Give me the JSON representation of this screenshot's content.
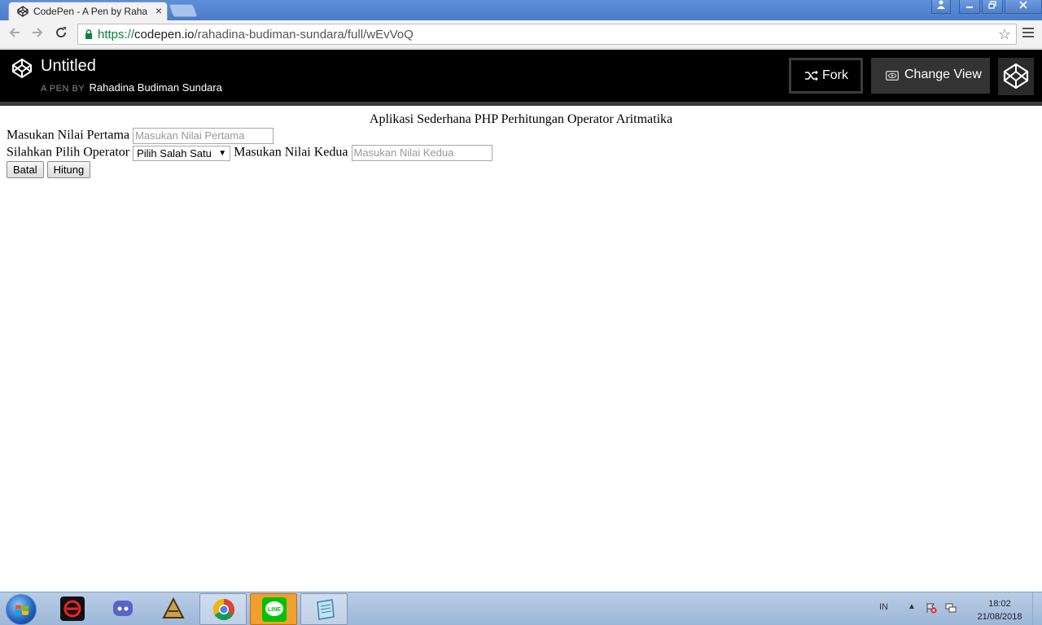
{
  "browser": {
    "tab_title": "CodePen - A Pen by Rahadina Budiman Sundara",
    "tab_close": "×",
    "url_protocol": "https://",
    "url_host": "codepen.io",
    "url_path": "/rahadina-budiman-sundara/full/wEvVoQ",
    "icons": [
      "back-icon",
      "forward-icon",
      "reload-icon",
      "lock-icon",
      "star-icon",
      "menu-icon"
    ]
  },
  "codepen": {
    "title": "Untitled",
    "by_label": "A PEN BY",
    "author": "Rahadina Budiman Sundara",
    "fork_label": "Fork",
    "change_view_label": "Change View"
  },
  "page": {
    "heading": "Aplikasi Sederhana PHP Perhitungan Operator Aritmatika",
    "label_first": "Masukan Nilai Pertama",
    "placeholder_first": "Masukan Nilai Pertama",
    "label_operator": "Silahkan Pilih Operator",
    "operator_selected": "Pilih Salah Satu",
    "label_second": "Masukan Nilai Kedua",
    "placeholder_second": "Masukan Nilai Kedua",
    "cancel_label": "Batal",
    "calc_label": "Hitung"
  },
  "taskbar": {
    "lang": "IN",
    "time": "18:02",
    "date": "21/08/2018",
    "apps": [
      "garena-icon",
      "discord-icon",
      "game-icon",
      "chrome-icon",
      "line-icon",
      "notepad-icon"
    ]
  },
  "colors": {
    "codepen_header": "#000000",
    "url_protocol": "#0b8043",
    "taskbar": "#a9c1e0"
  }
}
